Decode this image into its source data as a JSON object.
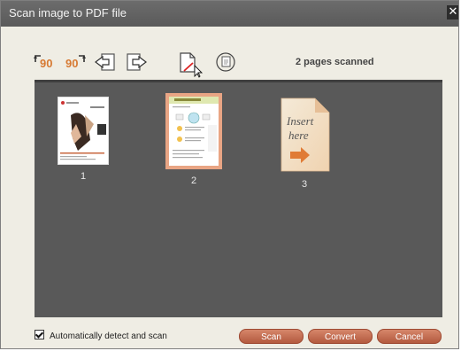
{
  "window": {
    "title": "Scan image to PDF file",
    "close_glyph": "✕"
  },
  "toolbar": {
    "rotate_left_label": "90",
    "rotate_right_label": "90",
    "buttons": [
      "rotate-left-90-icon",
      "rotate-right-90-icon",
      "move-page-left-icon",
      "move-page-right-icon",
      "delete-page-icon",
      "rescan-page-icon"
    ],
    "status": "2 pages scanned"
  },
  "pages": [
    {
      "number": "1",
      "kind": "scanned"
    },
    {
      "number": "2",
      "kind": "scanned",
      "selected": true
    },
    {
      "number": "3",
      "kind": "insert-placeholder",
      "placeholder_text": "Insert here"
    }
  ],
  "footer": {
    "auto_detect_label": "Automatically detect and scan",
    "auto_detect_checked": true,
    "scan_label": "Scan",
    "convert_label": "Convert",
    "cancel_label": "Cancel"
  },
  "colors": {
    "accent": "#c8673f",
    "viewer_bg": "#595959",
    "title_bg": "#616161"
  }
}
